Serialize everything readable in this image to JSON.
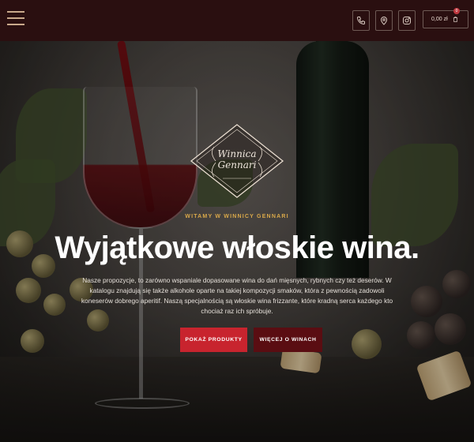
{
  "header": {
    "menu_icon": "hamburger-icon",
    "icons": [
      "phone-icon",
      "location-pin-icon",
      "instagram-icon"
    ],
    "cart": {
      "amount": "0,00 zł",
      "count": "0",
      "icon": "cart-icon"
    }
  },
  "hero": {
    "logo": {
      "line1": "Winnica",
      "line2": "Gennari"
    },
    "overline": "WITAMY W WINNICY GENNARI",
    "headline": "Wyjątkowe włoskie wina.",
    "lead": "Nasze propozycje, to zarówno wspaniale dopasowane wina do dań mięsnych, rybnych czy też deserów. W katalogu znajdują się także alkohole oparte na takiej kompozycji smaków, która z pewnością zadowoli koneserów dobrego aperitif. Naszą specjalnością są włoskie wina frizzante, które kradną serca każdego kto chociaż raz ich spróbuje.",
    "buttons": {
      "primary": "POKAŻ PRODUKTY",
      "secondary": "WIĘCEJ O WINACH"
    }
  },
  "colors": {
    "header_bg": "#2a0f10",
    "accent_gold": "#d9a84a",
    "primary_button": "#c8242e",
    "secondary_button": "#5a0d12"
  }
}
